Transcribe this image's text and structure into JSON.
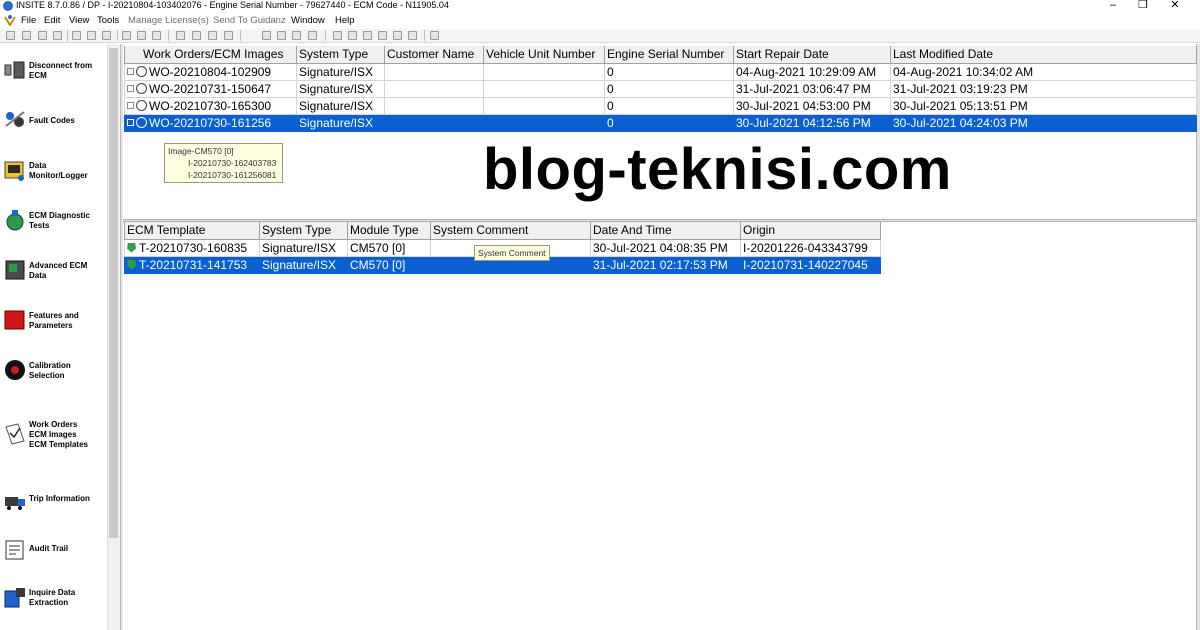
{
  "window": {
    "title": "INSITE 8.7.0.86  / DP - I-20210804-103402076 - Engine Serial Number - 79627440 - ECM Code -  N11905.04",
    "minimize": "–",
    "maximize": "❐",
    "close": "✕"
  },
  "menu": {
    "items": [
      {
        "label": "File",
        "enabled": true
      },
      {
        "label": "Edit",
        "enabled": true
      },
      {
        "label": "View",
        "enabled": true
      },
      {
        "label": "Tools",
        "enabled": true
      },
      {
        "label": "Manage License(s)",
        "enabled": false
      },
      {
        "label": "Send To Guidanz",
        "enabled": false
      },
      {
        "label": "Window",
        "enabled": true
      },
      {
        "label": "Help",
        "enabled": true
      }
    ]
  },
  "sidebar": {
    "items": [
      {
        "label": "Disconnect from\nECM",
        "icon": "disconnect-icon"
      },
      {
        "label": "Fault Codes",
        "icon": "fault-codes-icon"
      },
      {
        "label": "Data\nMonitor/Logger",
        "icon": "data-monitor-icon"
      },
      {
        "label": "ECM Diagnostic\nTests",
        "icon": "diagnostic-tests-icon"
      },
      {
        "label": "Advanced ECM\nData",
        "icon": "advanced-data-icon"
      },
      {
        "label": "Features and\nParameters",
        "icon": "features-icon"
      },
      {
        "label": "Calibration\nSelection",
        "icon": "calibration-icon"
      },
      {
        "label": "Work Orders\nECM Images\nECM Templates",
        "icon": "work-orders-icon"
      },
      {
        "label": "Trip Information",
        "icon": "trip-info-icon"
      },
      {
        "label": "Audit Trail",
        "icon": "audit-trail-icon"
      },
      {
        "label": "Inquire Data\nExtraction",
        "icon": "inquire-data-icon"
      }
    ]
  },
  "work_orders": {
    "columns": [
      "Work Orders/ECM Images",
      "System Type",
      "Customer Name",
      "Vehicle Unit Number",
      "Engine Serial Number",
      "Start Repair Date",
      "Last Modified Date"
    ],
    "rows": [
      {
        "name": "WO-20210804-102909",
        "system": "Signature/ISX",
        "customer": "",
        "unit": "",
        "esn": "0",
        "start": "04-Aug-2021 10:29:09 AM",
        "modified": "04-Aug-2021 10:34:02 AM",
        "selected": false
      },
      {
        "name": "WO-20210731-150647",
        "system": "Signature/ISX",
        "customer": "",
        "unit": "",
        "esn": "0",
        "start": "31-Jul-2021 03:06:47 PM",
        "modified": "31-Jul-2021 03:19:23 PM",
        "selected": false
      },
      {
        "name": "WO-20210730-165300",
        "system": "Signature/ISX",
        "customer": "",
        "unit": "",
        "esn": "0",
        "start": "30-Jul-2021 04:53:00 PM",
        "modified": "30-Jul-2021 05:13:51 PM",
        "selected": false
      },
      {
        "name": "WO-20210730-161256",
        "system": "Signature/ISX",
        "customer": "",
        "unit": "",
        "esn": "0",
        "start": "30-Jul-2021 04:12:56 PM",
        "modified": "30-Jul-2021 04:24:03 PM",
        "selected": true
      }
    ]
  },
  "image_tooltip": {
    "lines": [
      "Image-CM570 [0]",
      "I-20210730-162403783",
      "I-20210730-161256081"
    ]
  },
  "watermark": "blog-teknisi.com",
  "templates": {
    "columns": [
      "ECM Template",
      "System Type",
      "Module Type",
      "System Comment",
      "Date And Time",
      "Origin"
    ],
    "rows": [
      {
        "name": "T-20210730-160835",
        "system": "Signature/ISX",
        "module": "CM570 [0]",
        "comment": "",
        "datetime": "30-Jul-2021 04:08:35 PM",
        "origin": "I-20201226-043343799",
        "selected": false
      },
      {
        "name": "T-20210731-141753",
        "system": "Signature/ISX",
        "module": "CM570 [0]",
        "comment": "",
        "datetime": "31-Jul-2021 02:17:53 PM",
        "origin": "I-20210731-140227045",
        "selected": true
      }
    ]
  },
  "comment_tooltip": "System Comment",
  "colors": {
    "selection": "#0a5fd1",
    "tooltip_bg": "#ffffe1"
  }
}
